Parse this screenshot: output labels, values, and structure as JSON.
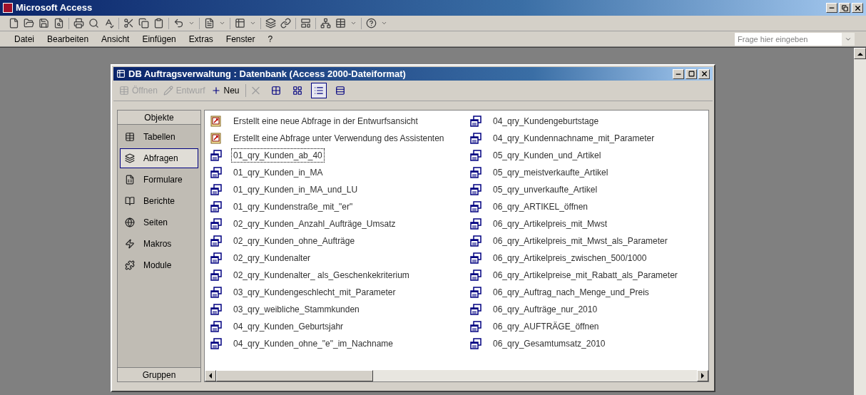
{
  "app": {
    "title": "Microsoft Access"
  },
  "menu": [
    {
      "label": "Datei"
    },
    {
      "label": "Bearbeiten"
    },
    {
      "label": "Ansicht"
    },
    {
      "label": "Einfügen"
    },
    {
      "label": "Extras"
    },
    {
      "label": "Fenster"
    },
    {
      "label": "?"
    }
  ],
  "help_box": {
    "placeholder": "Frage hier eingeben"
  },
  "db_window": {
    "title": "DB Auftragsverwaltung : Datenbank (Access 2000-Dateiformat)",
    "toolbar": [
      {
        "kind": "open",
        "label": "Öffnen",
        "disabled": true
      },
      {
        "kind": "design",
        "label": "Entwurf",
        "disabled": true
      },
      {
        "kind": "new",
        "label": "Neu",
        "disabled": false
      },
      {
        "kind": "delete",
        "disabled": true
      },
      {
        "kind": "large-icons",
        "selected": false
      },
      {
        "kind": "small-icons",
        "selected": false
      },
      {
        "kind": "list",
        "selected": true
      },
      {
        "kind": "details",
        "selected": false
      }
    ],
    "objects_header": "Objekte",
    "objects": [
      {
        "label": "Tabellen",
        "kind": "table",
        "selected": false
      },
      {
        "label": "Abfragen",
        "kind": "query",
        "selected": true
      },
      {
        "label": "Formulare",
        "kind": "form",
        "selected": false
      },
      {
        "label": "Berichte",
        "kind": "report",
        "selected": false
      },
      {
        "label": "Seiten",
        "kind": "page",
        "selected": false
      },
      {
        "label": "Makros",
        "kind": "macro",
        "selected": false
      },
      {
        "label": "Module",
        "kind": "module",
        "selected": false
      }
    ],
    "groups_header": "Gruppen",
    "items": [
      {
        "kind": "wizard",
        "label": "Erstellt eine neue Abfrage in der Entwurfsansicht",
        "focused": false
      },
      {
        "kind": "wizard",
        "label": "Erstellt eine Abfrage unter Verwendung des Assistenten",
        "focused": false
      },
      {
        "kind": "query",
        "label": "01_qry_Kunden_ab_40",
        "focused": true
      },
      {
        "kind": "query",
        "label": "01_qry_Kunden_in_MA",
        "focused": false
      },
      {
        "kind": "query",
        "label": "01_qry_Kunden_in_MA_und_LU",
        "focused": false
      },
      {
        "kind": "query",
        "label": "01_qry_Kundenstraße_mit_\"er\"",
        "focused": false
      },
      {
        "kind": "query",
        "label": "02_qry_Kunden_Anzahl_Aufträge_Umsatz",
        "focused": false
      },
      {
        "kind": "query",
        "label": "02_qry_Kunden_ohne_Aufträge",
        "focused": false
      },
      {
        "kind": "query",
        "label": "02_qry_Kundenalter",
        "focused": false
      },
      {
        "kind": "query",
        "label": "02_qry_Kundenalter_ als_Geschenkekriterium",
        "focused": false
      },
      {
        "kind": "query",
        "label": "03_qry_Kundengeschlecht_mit_Parameter",
        "focused": false
      },
      {
        "kind": "query",
        "label": "03_qry_weibliche_Stammkunden",
        "focused": false
      },
      {
        "kind": "query",
        "label": "04_qry_Kunden_Geburtsjahr",
        "focused": false
      },
      {
        "kind": "query",
        "label": "04_qry_Kunden_ohne_\"e\"_im_Nachname",
        "focused": false
      },
      {
        "kind": "query",
        "label": "04_qry_Kundengeburtstage",
        "focused": false
      },
      {
        "kind": "query",
        "label": "04_qry_Kundennachname_mit_Parameter",
        "focused": false
      },
      {
        "kind": "query",
        "label": "05_qry_Kunden_und_Artikel",
        "focused": false
      },
      {
        "kind": "query",
        "label": "05_qry_meistverkaufte_Artikel",
        "focused": false
      },
      {
        "kind": "query",
        "label": "05_qry_unverkaufte_Artikel",
        "focused": false
      },
      {
        "kind": "query",
        "label": "06_qry_ARTIKEL_öffnen",
        "focused": false
      },
      {
        "kind": "query",
        "label": "06_qry_Artikelpreis_mit_Mwst",
        "focused": false
      },
      {
        "kind": "query",
        "label": "06_qry_Artikelpreis_mit_Mwst_als_Parameter",
        "focused": false
      },
      {
        "kind": "query",
        "label": "06_qry_Artikelpreis_zwischen_500/1000",
        "focused": false
      },
      {
        "kind": "query",
        "label": "06_qry_Artikelpreise_mit_Rabatt_als_Parameter",
        "focused": false
      },
      {
        "kind": "query",
        "label": "06_qry_Auftrag_nach_Menge_und_Preis",
        "focused": false
      },
      {
        "kind": "query",
        "label": "06_qry_Aufträge_nur_2010",
        "focused": false
      },
      {
        "kind": "query",
        "label": "06_qry_AUFTRÄGE_öffnen",
        "focused": false
      },
      {
        "kind": "query",
        "label": "06_qry_Gesamtumsatz_2010",
        "focused": false
      }
    ]
  }
}
